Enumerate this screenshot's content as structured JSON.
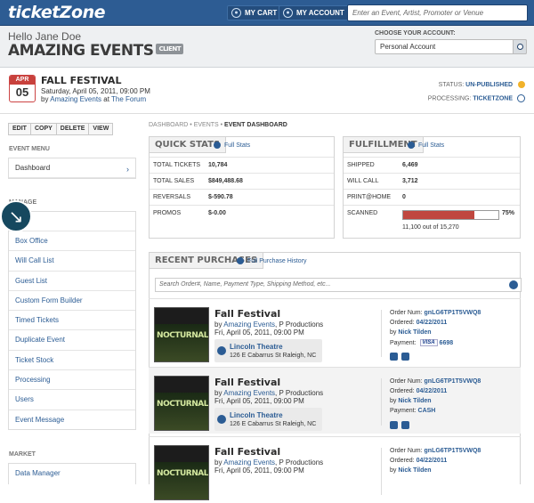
{
  "topbar": {
    "logo": "ticketZone",
    "my_cart": "MY CART",
    "my_account": "MY ACCOUNT",
    "search_placeholder": "Enter an Event, Artist, Promoter or Venue"
  },
  "header": {
    "hello": "Hello Jane Doe",
    "account_name": "AMAZING EVENTS",
    "badge": "CLIENT",
    "choose_label": "CHOOSE YOUR ACCOUNT:",
    "choose_value": "Personal Account"
  },
  "event": {
    "month": "APR",
    "day": "05",
    "title": "FALL FESTIVAL",
    "datetime": "Saturday, April 05, 2011, 09:00 PM",
    "by": "by",
    "promoter": "Amazing Events",
    "at": "at",
    "venue": "The Forum",
    "status_label": "STATUS:",
    "status_value": "UN-PUBLISHED",
    "processing_label": "PROCESSING:",
    "processing_value": "TICKETZONE"
  },
  "actions": [
    "EDIT",
    "COPY",
    "DELETE",
    "VIEW"
  ],
  "sidebar": {
    "event_menu_caption": "EVENT MENU",
    "dashboard": "Dashboard",
    "manage_caption": "MANAGE",
    "manage_items": [
      "Box Office",
      "Will Call List",
      "Guest List",
      "Custom Form Builder",
      "Timed Tickets",
      "Duplicate Event",
      "Ticket Stock",
      "Processing",
      "Users",
      "Event Message"
    ],
    "market_caption": "MARKET",
    "market_items": [
      "Data Manager"
    ]
  },
  "breadcrumb": {
    "a": "DASHBOARD",
    "b": "EVENTS",
    "c": "EVENT DASHBOARD"
  },
  "quick_stats": {
    "title": "QUICK STATS",
    "link": "Full Stats",
    "rows": [
      {
        "label": "TOTAL TICKETS",
        "value": "10,784"
      },
      {
        "label": "TOTAL SALES",
        "value": "$849,488.68"
      },
      {
        "label": "REVERSALS",
        "value": "$-590.78"
      },
      {
        "label": "PROMOS",
        "value": "$-0.00"
      }
    ]
  },
  "fulfillment": {
    "title": "FULFILLMENT",
    "link": "Full Stats",
    "rows": [
      {
        "label": "SHIPPED",
        "value": "6,469"
      },
      {
        "label": "WILL CALL",
        "value": "3,712"
      },
      {
        "label": "PRINT@HOME",
        "value": "0"
      }
    ],
    "scanned_label": "SCANNED",
    "scanned_fraction": 0.75,
    "scanned_pct": "75%",
    "scanned_of": "11,100 out of 15,270"
  },
  "recent": {
    "title": "RECENT PURCHASES",
    "link": "Full Purchase History",
    "search_placeholder": "Search Order#, Name, Payment Type, Shipping Method, etc...",
    "items": [
      {
        "thumb": "NOCTURNAL",
        "title": "Fall Festival",
        "by": "by",
        "promoter": "Amazing Events",
        "co": ", P Productions",
        "date": "Fri, April 05, 2011, 09:00 PM",
        "venue": "Lincoln Theatre",
        "address": "126 E Cabarrus St Raleigh, NC",
        "order_label": "Order Num:",
        "order": "gnLG6TP1T5VWQ8",
        "ordered_label": "Ordered:",
        "ordered": "04/22/2011",
        "by_label": "by",
        "buyer": "Nick Tilden",
        "payment_label": "Payment:",
        "card": "VISA",
        "payment": "6698"
      },
      {
        "thumb": "NOCTURNAL",
        "title": "Fall Festival",
        "by": "by",
        "promoter": "Amazing Events",
        "co": ", P Productions",
        "date": "Fri, April 05, 2011, 09:00 PM",
        "venue": "Lincoln Theatre",
        "address": "126 E Cabarrus St Raleigh, NC",
        "order_label": "Order Num:",
        "order": "gnLG6TP1T5VWQ8",
        "ordered_label": "Ordered:",
        "ordered": "04/22/2011",
        "by_label": "by",
        "buyer": "Nick Tilden",
        "payment_label": "Payment:",
        "card": "",
        "payment": "CASH"
      },
      {
        "thumb": "NOCTURNAL",
        "title": "Fall Festival",
        "by": "by",
        "promoter": "Amazing Events",
        "co": ", P Productions",
        "date": "Fri, April 05, 2011, 09:00 PM",
        "venue": "",
        "address": "",
        "order_label": "Order Num:",
        "order": "gnLG6TP1T5VWQ8",
        "ordered_label": "Ordered:",
        "ordered": "04/22/2011",
        "by_label": "by",
        "buyer": "Nick Tilden",
        "payment_label": "",
        "card": "",
        "payment": ""
      }
    ]
  }
}
